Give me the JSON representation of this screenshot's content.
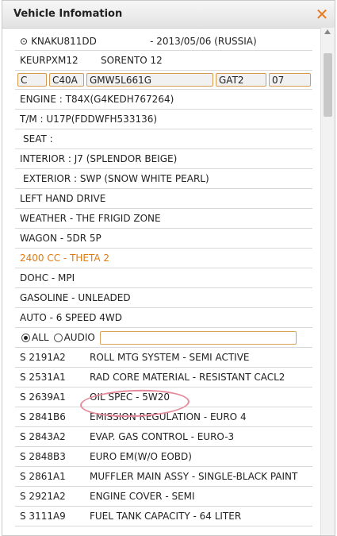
{
  "window": {
    "title": "Vehicle Infomation",
    "close_icon": "close-x-icon"
  },
  "vin_row": {
    "vin": "KNAKU811DD",
    "date_country": "- 2013/05/06 (RUSSIA)"
  },
  "model_row": {
    "model_code": "KEURPXM12",
    "model_name": "SORENTO 12"
  },
  "codes": [
    "C",
    "C40A",
    "GMW5L661G",
    "GAT2",
    "07"
  ],
  "spec_lines": [
    "ENGINE : T84X(G4KEDH767264)",
    "T/M : U17P(FDDWFH533136)",
    "SEAT :",
    "INTERIOR : J7 (SPLENDOR BEIGE)",
    "EXTERIOR : SWP (SNOW WHITE PEARL)",
    "LEFT HAND DRIVE",
    "WEATHER - THE FRIGID ZONE",
    "WAGON - 5DR 5P",
    "2400 CC - THETA 2",
    "DOHC - MPI",
    "GASOLINE - UNLEADED",
    "AUTO - 6 SPEED 4WD"
  ],
  "filter": {
    "all_label": "ALL",
    "audio_label": "AUDIO",
    "selected": "ALL",
    "input_value": ""
  },
  "options": [
    {
      "code": "S 2191A2",
      "desc": "ROLL MTG SYSTEM - SEMI ACTIVE"
    },
    {
      "code": "S 2531A1",
      "desc": "RAD CORE MATERIAL - RESISTANT CACL2"
    },
    {
      "code": "S 2639A1",
      "desc": "OIL SPEC - 5W20"
    },
    {
      "code": "S 2841B6",
      "desc": "EMISSION REGULATION - EURO 4"
    },
    {
      "code": "S 2843A2",
      "desc": "EVAP. GAS CONTROL - EURO-3"
    },
    {
      "code": "S 2848B3",
      "desc": "EURO EM(W/O EOBD)"
    },
    {
      "code": "S 2861A1",
      "desc": "MUFFLER MAIN ASSY - SINGLE-BLACK PAINT"
    },
    {
      "code": "S 2921A2",
      "desc": "ENGINE COVER - SEMI"
    },
    {
      "code": "S 3111A9",
      "desc": "FUEL TANK CAPACITY - 64 LITER"
    }
  ],
  "colors": {
    "accent": "#e07a12",
    "highlight_circle": "#e58a9a"
  }
}
